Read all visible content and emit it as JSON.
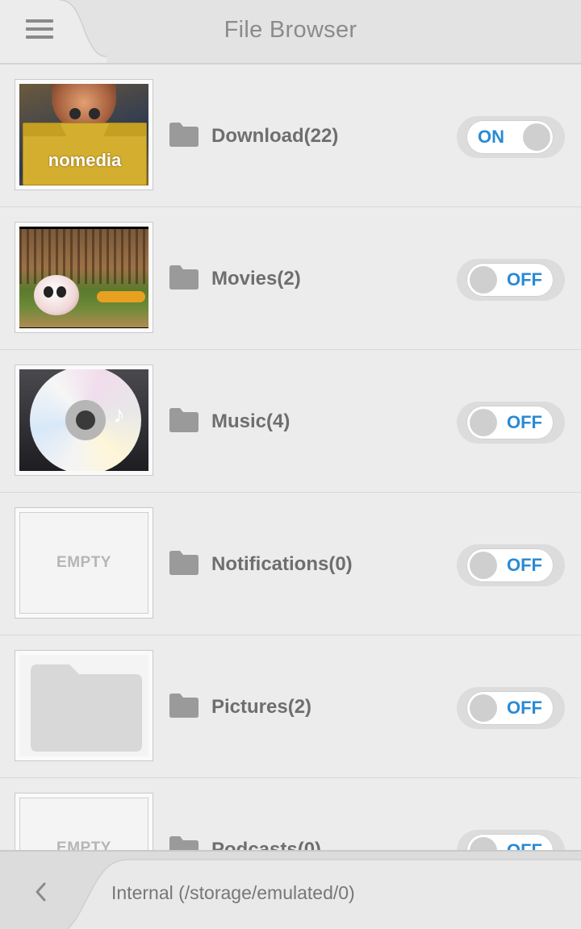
{
  "header": {
    "title": "File Browser",
    "menu_icon": "hamburger-menu-icon"
  },
  "folders": [
    {
      "name": "Download(22)",
      "thumbnail": "nomedia-image",
      "thumbnail_text": "nomedia",
      "toggle": "ON"
    },
    {
      "name": "Movies(2)",
      "thumbnail": "movie-still-image",
      "toggle": "OFF"
    },
    {
      "name": "Music(4)",
      "thumbnail": "cd-disc-image",
      "toggle": "OFF"
    },
    {
      "name": "Notifications(0)",
      "thumbnail": "empty",
      "thumbnail_text": "EMPTY",
      "toggle": "OFF"
    },
    {
      "name": "Pictures(2)",
      "thumbnail": "folder-placeholder-image",
      "toggle": "OFF"
    },
    {
      "name": "Podcasts(0)",
      "thumbnail": "empty",
      "thumbnail_text": "EMPTY",
      "toggle": "OFF"
    }
  ],
  "footer": {
    "path": "Internal (/storage/emulated/0)",
    "back_icon": "chevron-left-icon"
  },
  "colors": {
    "accent": "#2a8ad4",
    "folder_icon": "#9a9a9a",
    "header_bg": "#e3e3e3"
  }
}
